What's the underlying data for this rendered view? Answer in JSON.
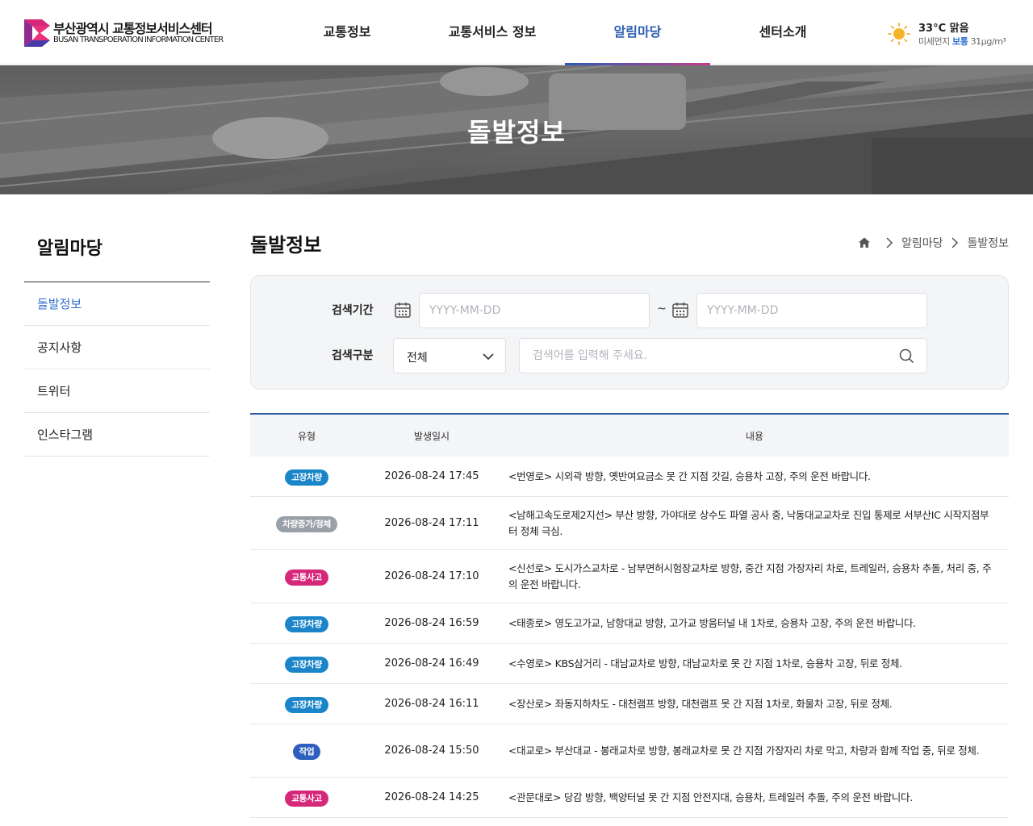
{
  "header": {
    "logo_kr": "부산광역시 교통정보서비스센터",
    "logo_en": "BUSAN TRANSPOERATION INFORMATION CENTER",
    "nav": [
      {
        "label": "교통정보"
      },
      {
        "label": "교통서비스 정보"
      },
      {
        "label": "알림마당"
      },
      {
        "label": "센터소개"
      }
    ],
    "weather": {
      "temp": "33°C 맑음",
      "dust_label": "미세먼지",
      "dust_status": "보통",
      "dust_value": "31μg/m³"
    }
  },
  "hero": {
    "title": "돌발정보"
  },
  "sidebar": {
    "title": "알림마당",
    "items": [
      {
        "label": "돌발정보"
      },
      {
        "label": "공지사항"
      },
      {
        "label": "트위터"
      },
      {
        "label": "인스타그램"
      }
    ]
  },
  "main": {
    "title": "돌발정보",
    "breadcrumb": [
      "알림마당",
      "돌발정보"
    ]
  },
  "search": {
    "period_label": "검색기간",
    "start_placeholder": "YYYY-MM-DD",
    "end_placeholder": "YYYY-MM-DD",
    "tilde": "~",
    "type_label": "검색구분",
    "type_value": "전체",
    "keyword_placeholder": "검색어를 입력해 주세요."
  },
  "table": {
    "headers": [
      "유형",
      "발생일시",
      "내용"
    ],
    "rows": [
      {
        "type": "고장차량",
        "color": "#1a86c9",
        "date": "2026-08-24 17:45",
        "text": "<번영로> 시외곽 방향, 옛반여요금소 못 간 지점 갓길, 승용차 고장, 주의 운전 바랍니다."
      },
      {
        "type": "차량증가/정체",
        "color": "#9aa0a8",
        "date": "2026-08-24 17:11",
        "text": "<남해고속도로제2지선> 부산 방향, 가야대로 상수도 파열 공사 중, 낙동대교교차로 진입 통제로 서부산IC 시작지점부터 정체 극심."
      },
      {
        "type": "교통사고",
        "color": "#d6287a",
        "date": "2026-08-24 17:10",
        "text": "<신선로> 도시가스교차로 - 남부면허시험장교차로 방향, 중간 지점 가장자리 차로, 트레일러, 승용차 추돌, 처리 중, 주의 운전 바랍니다."
      },
      {
        "type": "고장차량",
        "color": "#1a86c9",
        "date": "2026-08-24 16:59",
        "text": "<태종로> 영도고가교, 남항대교 방향, 고가교 방음터널 내 1차로, 승용차 고장, 주의 운전 바랍니다."
      },
      {
        "type": "고장차량",
        "color": "#1a86c9",
        "date": "2026-08-24 16:49",
        "text": "<수영로> KBS삼거리 - 대남교차로 방향, 대남교차로 못 간 지점 1차로, 승용차 고장, 뒤로 정체."
      },
      {
        "type": "고장차량",
        "color": "#1a86c9",
        "date": "2026-08-24 16:11",
        "text": "<장산로> 좌동지하차도 - 대천램프 방향, 대천램프 못 간 지점 1차로, 화물차 고장, 뒤로 정체."
      },
      {
        "type": "작업",
        "color": "#2e5fbf",
        "date": "2026-08-24 15:50",
        "text": "<대교로> 부산대교 - 봉래교차로 방향, 봉래교차로 못 간 지점 가장자리 차로 막고, 차량과 함께 작업 중, 뒤로 정체."
      },
      {
        "type": "교통사고",
        "color": "#d6287a",
        "date": "2026-08-24 14:25",
        "text": "<관문대로> 당감 방향, 백양터널 못 간 지점 안전지대, 승용차, 트레일러 추돌, 주의 운전 바랍니다."
      }
    ]
  }
}
